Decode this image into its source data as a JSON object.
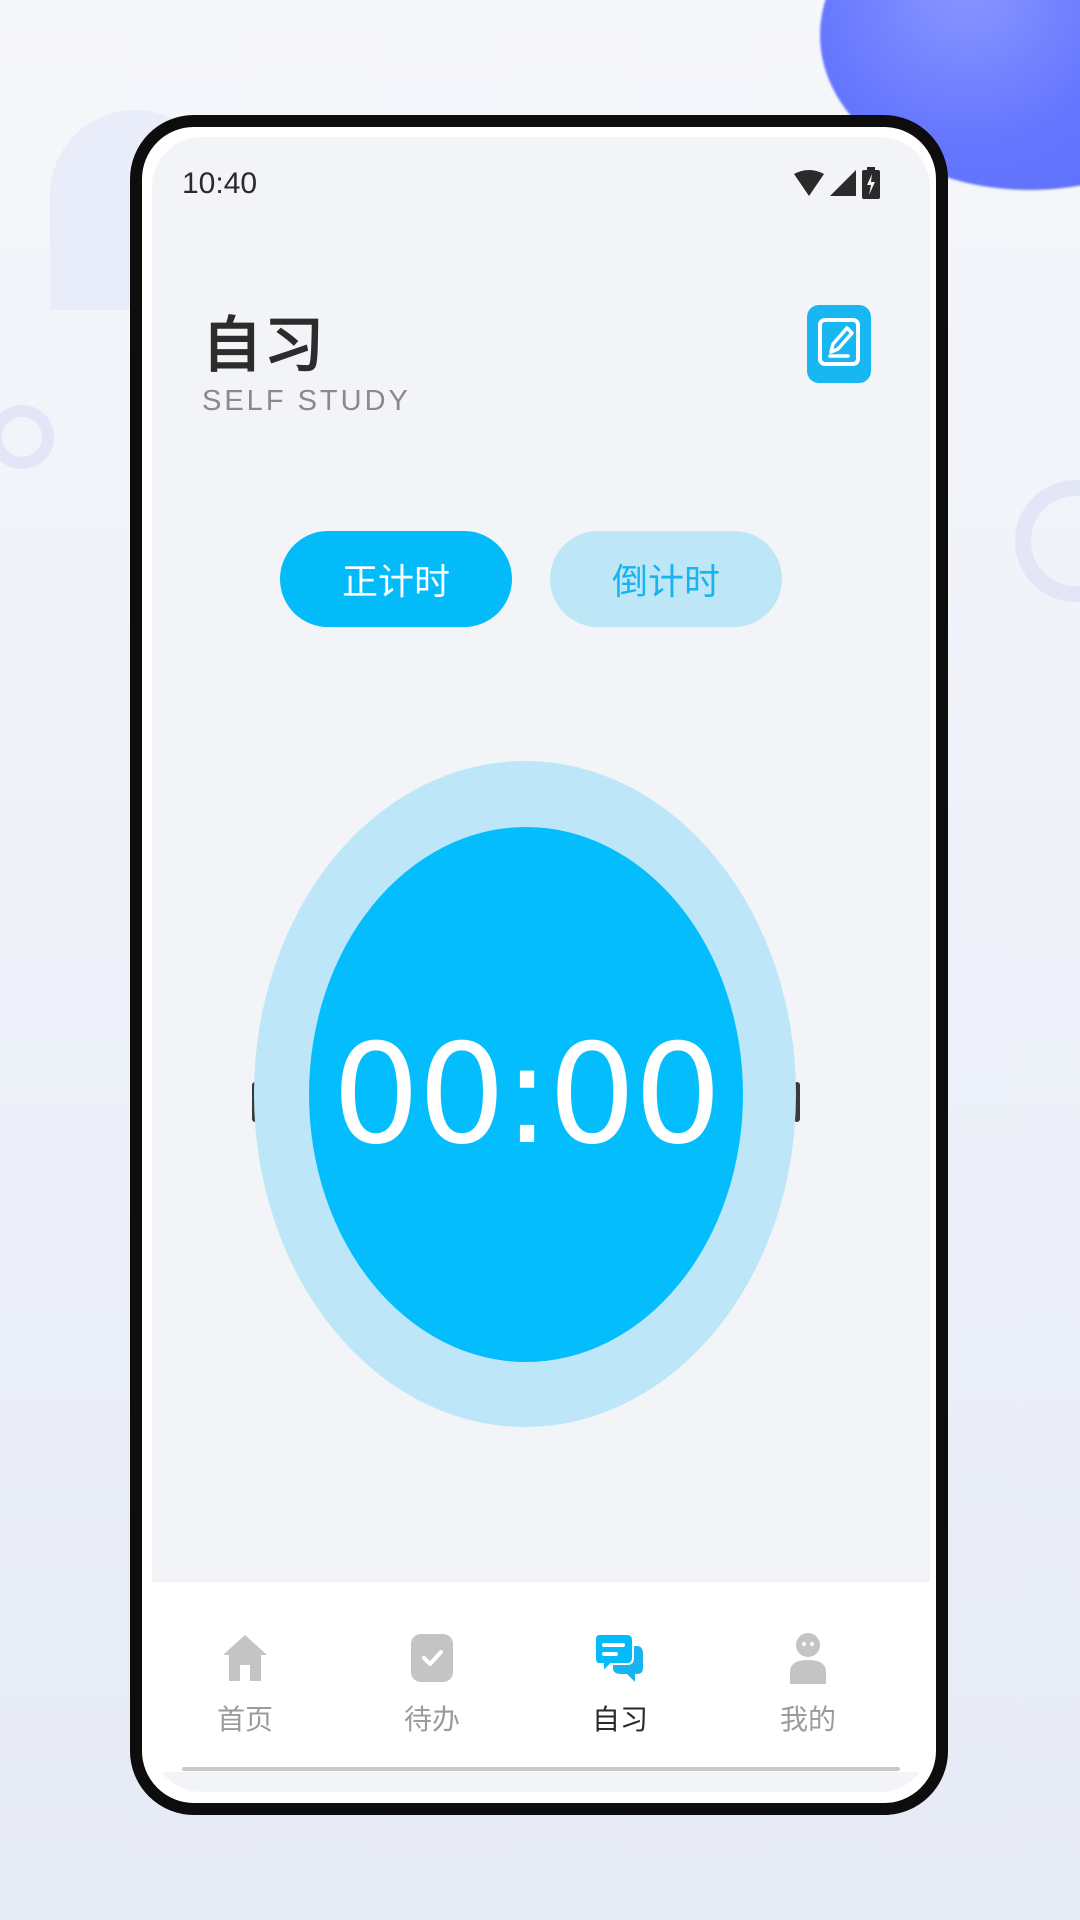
{
  "status_bar": {
    "time": "10:40"
  },
  "header": {
    "title": "自习",
    "subtitle": "SELF STUDY"
  },
  "mode_toggle": {
    "count_up_label": "正计时",
    "count_down_label": "倒计时",
    "selected": "正计时"
  },
  "timer": {
    "display": "00:00"
  },
  "tab_bar": {
    "items": [
      {
        "label": "首页",
        "icon": "home-icon",
        "active": false
      },
      {
        "label": "待办",
        "icon": "todo-check-icon",
        "active": false
      },
      {
        "label": "自习",
        "icon": "chat-bubbles-icon",
        "active": true
      },
      {
        "label": "我的",
        "icon": "user-icon",
        "active": false
      }
    ]
  },
  "colors": {
    "accent": "#04bbf9",
    "accent_light": "#bde6f7",
    "background": "#f2f4f7",
    "tab_inactive": "#c4c4c4"
  }
}
